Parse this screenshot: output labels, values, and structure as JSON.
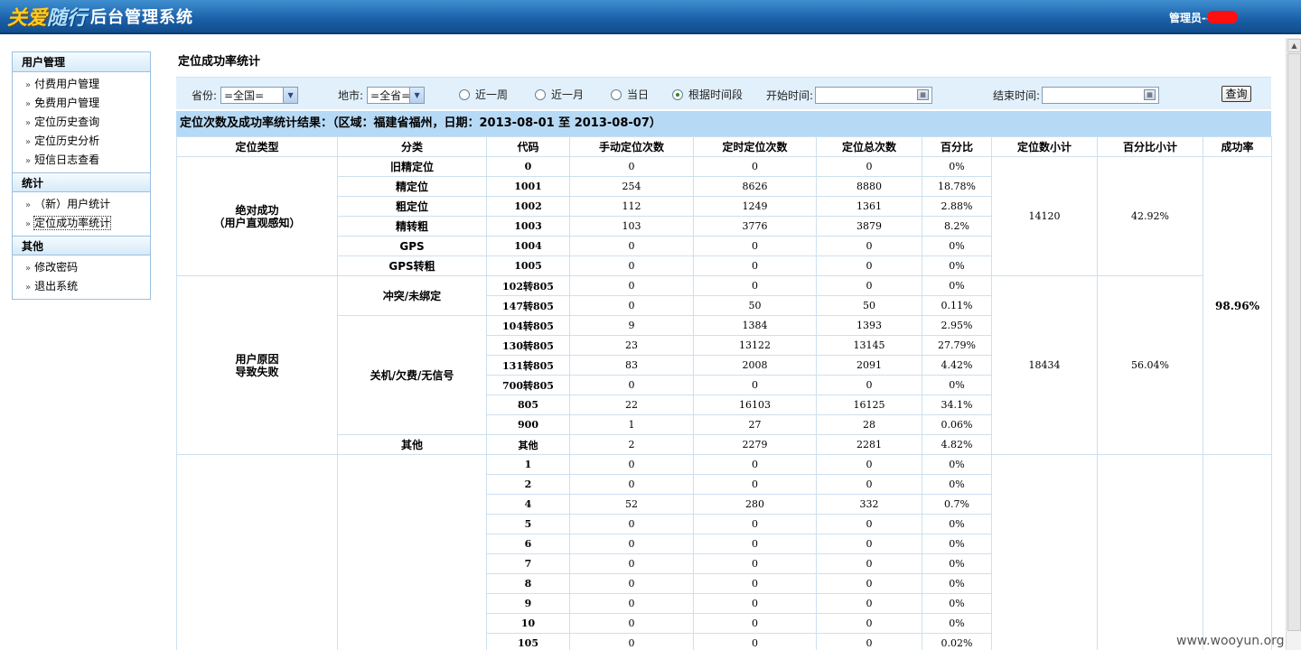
{
  "header": {
    "logo_a": "关爱",
    "logo_b": "随行",
    "logo_c": "后台管理系统",
    "admin_label": "管理员--"
  },
  "sidebar": {
    "sections": [
      {
        "title": "用户管理",
        "items": [
          "付费用户管理",
          "免费用户管理",
          "定位历史查询",
          "定位历史分析",
          "短信日志查看"
        ]
      },
      {
        "title": "统计",
        "items": [
          "（新）用户统计",
          "定位成功率统计"
        ]
      },
      {
        "title": "其他",
        "items": [
          "修改密码",
          "退出系统"
        ]
      }
    ],
    "active": "定位成功率统计"
  },
  "page_title": "定位成功率统计",
  "filter": {
    "province_label": "省份:",
    "province_value": "=全国=",
    "city_label": "地市:",
    "city_value": "=全省=",
    "radios": [
      "近一周",
      "近一月",
      "当日",
      "根据时间段"
    ],
    "selected_radio": "根据时间段",
    "start_label": "开始时间:",
    "end_label": "结束时间:",
    "query_button": "查询"
  },
  "result_title": "定位次数及成功率统计结果：（区域：福建省福州，日期：2013-08-01 至  2013-08-07）",
  "table": {
    "headers": [
      "定位类型",
      "分类",
      "代码",
      "手动定位次数",
      "定时定位次数",
      "定位总次数",
      "百分比",
      "定位数小计",
      "百分比小计",
      "成功率"
    ],
    "group1": {
      "type": "绝对成功\n（用户直观感知）",
      "subtotal": "14120",
      "pct_subtotal": "42.92%",
      "rows": [
        [
          "旧精定位",
          "0",
          "0",
          "0",
          "0",
          "0%"
        ],
        [
          "精定位",
          "1001",
          "254",
          "8626",
          "8880",
          "18.78%"
        ],
        [
          "粗定位",
          "1002",
          "112",
          "1249",
          "1361",
          "2.88%"
        ],
        [
          "精转粗",
          "1003",
          "103",
          "3776",
          "3879",
          "8.2%"
        ],
        [
          "GPS",
          "1004",
          "0",
          "0",
          "0",
          "0%"
        ],
        [
          "GPS转粗",
          "1005",
          "0",
          "0",
          "0",
          "0%"
        ]
      ]
    },
    "success_rate": "98.96%",
    "group2": {
      "type": "用户原因\n导致失败",
      "subtotal": "18434",
      "pct_subtotal": "56.04%",
      "cat_a": "冲突/未绑定",
      "cat_a_rows": [
        [
          "102转805",
          "0",
          "0",
          "0",
          "0%"
        ],
        [
          "147转805",
          "0",
          "50",
          "50",
          "0.11%"
        ]
      ],
      "cat_b": "关机/欠费/无信号",
      "cat_b_rows": [
        [
          "104转805",
          "9",
          "1384",
          "1393",
          "2.95%"
        ],
        [
          "130转805",
          "23",
          "13122",
          "13145",
          "27.79%"
        ],
        [
          "131转805",
          "83",
          "2008",
          "2091",
          "4.42%"
        ],
        [
          "700转805",
          "0",
          "0",
          "0",
          "0%"
        ],
        [
          "805",
          "22",
          "16103",
          "16125",
          "34.1%"
        ],
        [
          "900",
          "1",
          "27",
          "28",
          "0.06%"
        ]
      ],
      "cat_c": "其他",
      "cat_c_row": [
        "其他",
        "2",
        "2279",
        "2281",
        "4.82%"
      ]
    },
    "group3_rows": [
      [
        "1",
        "0",
        "0",
        "0",
        "0%"
      ],
      [
        "2",
        "0",
        "0",
        "0",
        "0%"
      ],
      [
        "4",
        "52",
        "280",
        "332",
        "0.7%"
      ],
      [
        "5",
        "0",
        "0",
        "0",
        "0%"
      ],
      [
        "6",
        "0",
        "0",
        "0",
        "0%"
      ],
      [
        "7",
        "0",
        "0",
        "0",
        "0%"
      ],
      [
        "8",
        "0",
        "0",
        "0",
        "0%"
      ],
      [
        "9",
        "0",
        "0",
        "0",
        "0%"
      ],
      [
        "10",
        "0",
        "0",
        "0",
        "0%"
      ],
      [
        "105",
        "0",
        "0",
        "0",
        "0.02%"
      ]
    ]
  },
  "watermark": "www.wooyun.org"
}
